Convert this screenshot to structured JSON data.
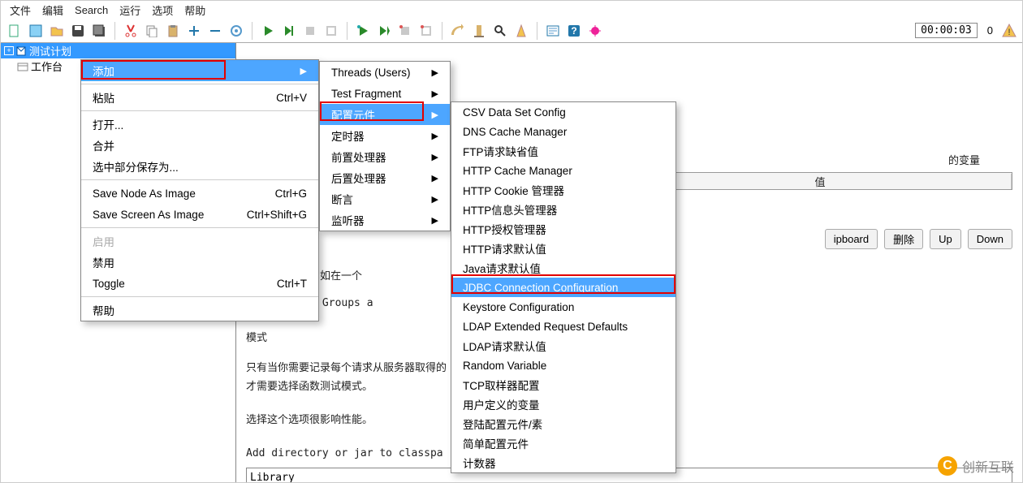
{
  "menubar": {
    "items": [
      "文件",
      "编辑",
      "Search",
      "运行",
      "选项",
      "帮助"
    ]
  },
  "toolbar": {
    "timer": "00:00:03",
    "warn_count": "0"
  },
  "tree": {
    "root": "测试计划",
    "child": "工作台"
  },
  "context1": {
    "items": [
      {
        "label": "添加",
        "arrow": true,
        "highlight": true
      },
      {
        "sep": true
      },
      {
        "label": "粘贴",
        "shortcut": "Ctrl+V"
      },
      {
        "sep": true
      },
      {
        "label": "打开...",
        "shortcut": ""
      },
      {
        "label": "合并",
        "shortcut": ""
      },
      {
        "label": "选中部分保存为...",
        "shortcut": ""
      },
      {
        "sep": true
      },
      {
        "label": "Save Node As Image",
        "shortcut": "Ctrl+G"
      },
      {
        "label": "Save Screen As Image",
        "shortcut": "Ctrl+Shift+G"
      },
      {
        "sep": true
      },
      {
        "label": "启用",
        "disabled": true
      },
      {
        "label": "禁用"
      },
      {
        "label": "Toggle",
        "shortcut": "Ctrl+T"
      },
      {
        "sep": true
      },
      {
        "label": "帮助"
      }
    ]
  },
  "context2": {
    "items": [
      {
        "label": "Threads (Users)",
        "arrow": true
      },
      {
        "label": "Test Fragment",
        "arrow": true
      },
      {
        "label": "配置元件",
        "arrow": true,
        "highlight": true
      },
      {
        "label": "定时器",
        "arrow": true
      },
      {
        "label": "前置处理器",
        "arrow": true
      },
      {
        "label": "后置处理器",
        "arrow": true
      },
      {
        "label": "断言",
        "arrow": true
      },
      {
        "label": "监听器",
        "arrow": true
      }
    ]
  },
  "context3": {
    "items": [
      "CSV Data Set Config",
      "DNS Cache Manager",
      "FTP请求缺省值",
      "HTTP Cache Manager",
      "HTTP Cookie 管理器",
      "HTTP信息头管理器",
      "HTTP授权管理器",
      "HTTP请求默认值",
      "Java请求默认值",
      "JDBC Connection Configuration",
      "Keystore Configuration",
      "LDAP Extended Request Defaults",
      "LDAP请求默认值",
      "Random Variable",
      "TCP取样器配置",
      "用户定义的变量",
      "登陆配置元件/素",
      "简单配置元件",
      "计数器"
    ],
    "highlight_index": 9
  },
  "editor": {
    "var_suffix": "的变量",
    "col_value": "值",
    "btn_clipboard": "ipboard",
    "btn_delete": "删除",
    "btn_up": "Up",
    "btn_down": "Down",
    "hint_line1": "每个线程组（例如在一个",
    "hint_line2": "Down Thread Groups a",
    "hint_mode": "模式",
    "hint_para1": "只有当你需要记录每个请求从服务器取得的",
    "hint_para2": "才需要选择函数测试模式。",
    "hint_perf": "选择这个选项很影响性能。",
    "classpath_label": "Add directory or jar to classpa",
    "library_value": "Library"
  },
  "watermark": {
    "text": "创新互联"
  }
}
